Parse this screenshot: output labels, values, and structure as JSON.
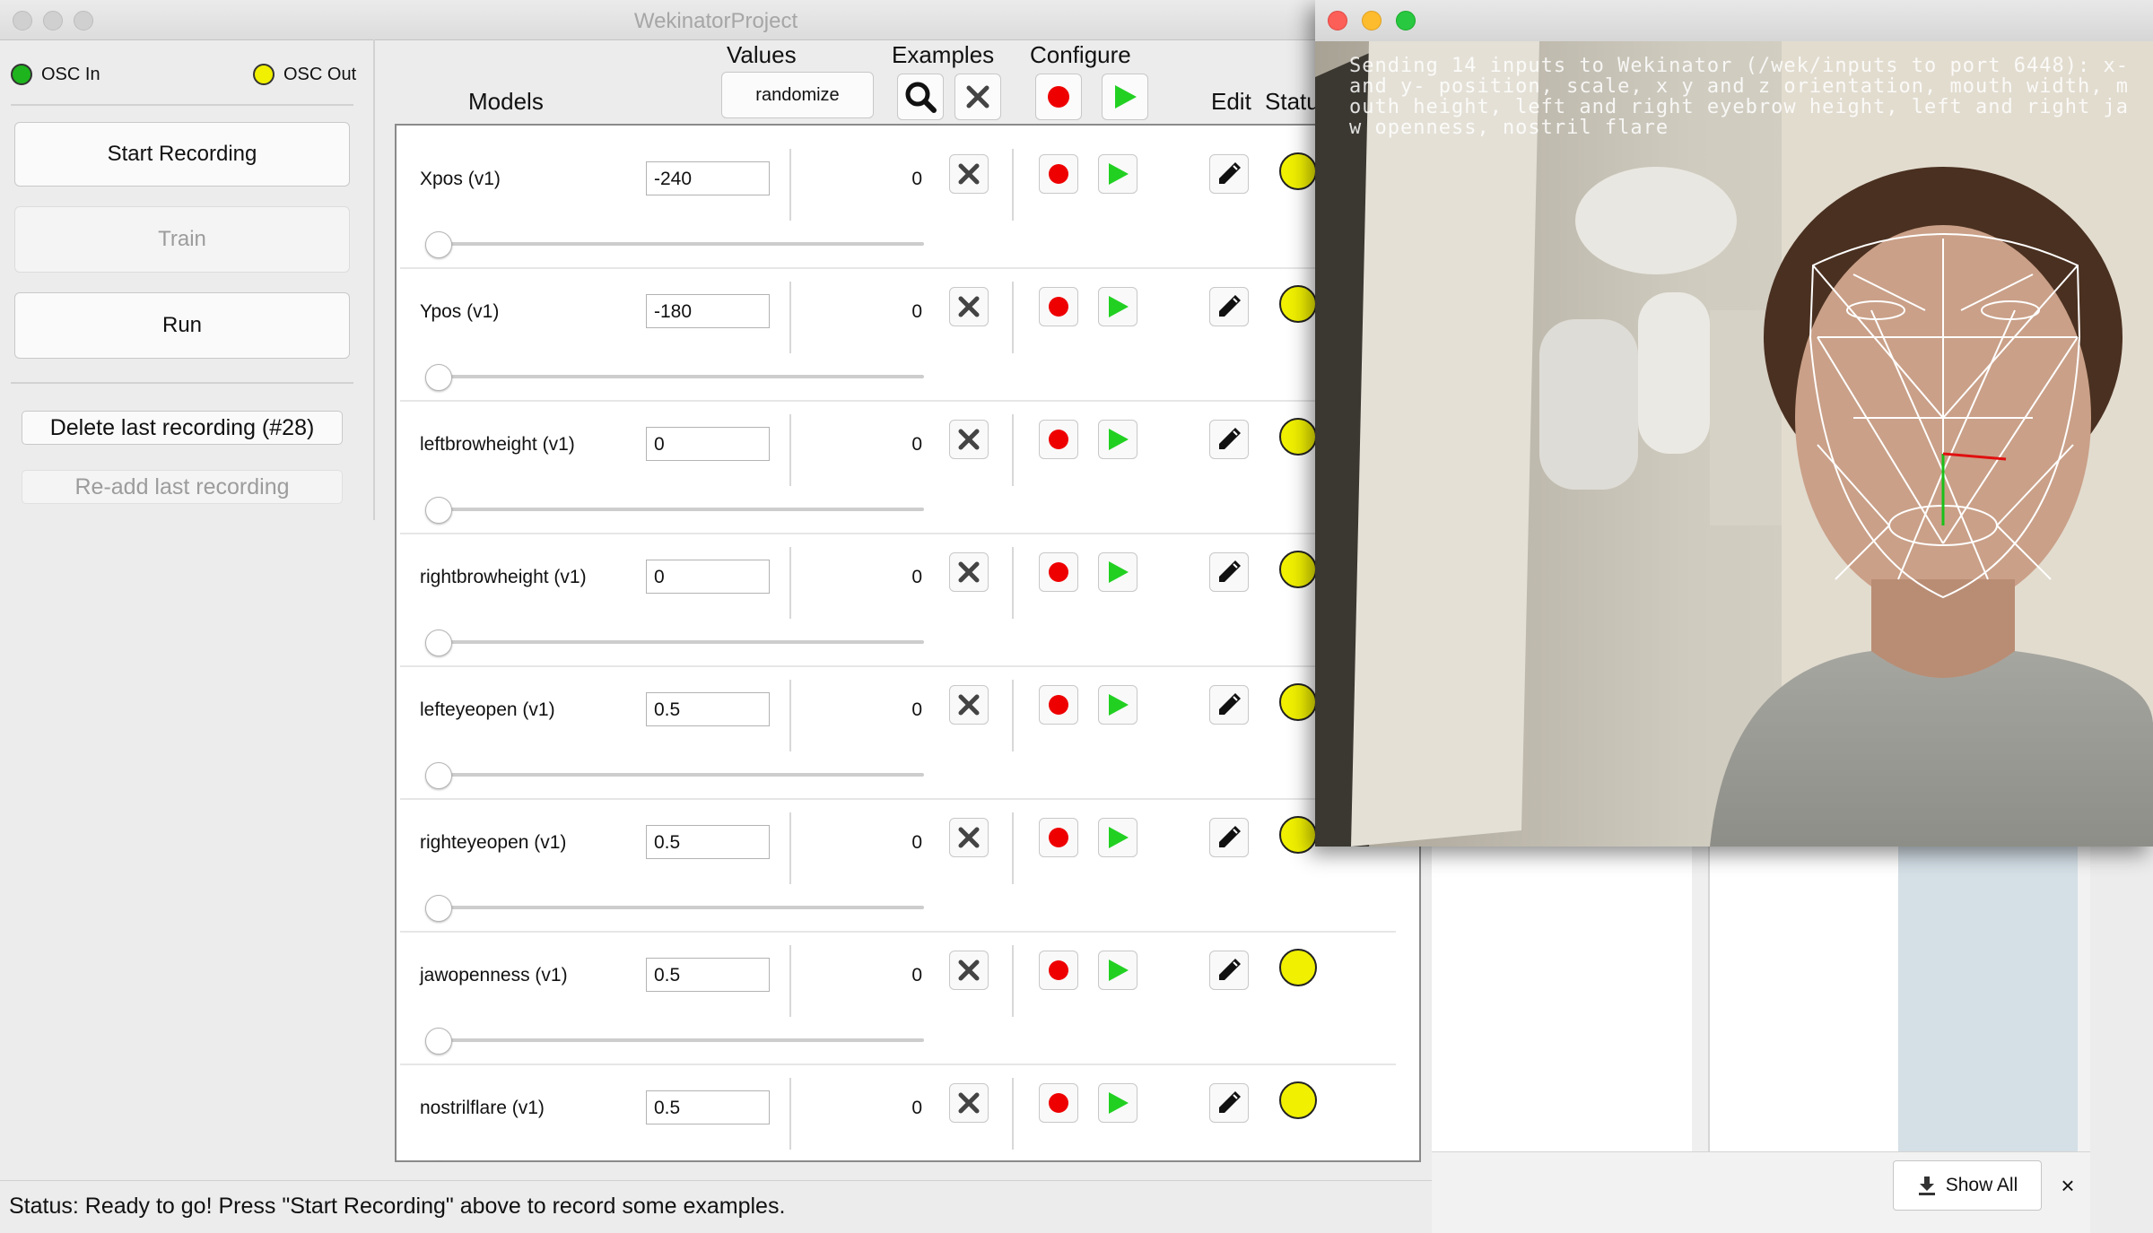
{
  "window": {
    "title": "WekinatorProject"
  },
  "osc": {
    "in_label": "OSC In",
    "out_label": "OSC Out",
    "in_color": "#1db41d",
    "out_color": "#f0f000"
  },
  "left_panel": {
    "start_recording": "Start Recording",
    "train": "Train",
    "run": "Run",
    "delete_last": "Delete last recording (#28)",
    "readd_last": "Re-add last recording"
  },
  "headers": {
    "models": "Models",
    "values": "Values",
    "randomize": "randomize",
    "examples": "Examples",
    "configure": "Configure",
    "edit": "Edit",
    "status": "Statu"
  },
  "models": [
    {
      "name": "Xpos (v1)",
      "value": "-240",
      "examples": "0"
    },
    {
      "name": "Ypos (v1)",
      "value": "-180",
      "examples": "0"
    },
    {
      "name": "leftbrowheight (v1)",
      "value": "0",
      "examples": "0"
    },
    {
      "name": "rightbrowheight (v1)",
      "value": "0",
      "examples": "0"
    },
    {
      "name": "lefteyeopen (v1)",
      "value": "0.5",
      "examples": "0"
    },
    {
      "name": "righteyeopen (v1)",
      "value": "0.5",
      "examples": "0"
    },
    {
      "name": "jawopenness (v1)",
      "value": "0.5",
      "examples": "0"
    },
    {
      "name": "nostrilflare (v1)",
      "value": "0.5",
      "examples": "0"
    }
  ],
  "status_bar": {
    "text": "Status:  Ready to go! Press \"Start Recording\" above to record some examples."
  },
  "camera_window": {
    "overlay_text": "Sending 14 inputs to Wekinator (/wek/inputs to port 6448): x- and y- position, scale, x y and z orientation, mouth width, mouth height, left and right eyebrow height, left and right jaw openness, nostril flare"
  },
  "browser": {
    "show_all": "Show All",
    "close": "×"
  },
  "colors": {
    "record_red": "#ee0000",
    "play_green": "#22d022",
    "status_yellow": "#f0f000"
  }
}
